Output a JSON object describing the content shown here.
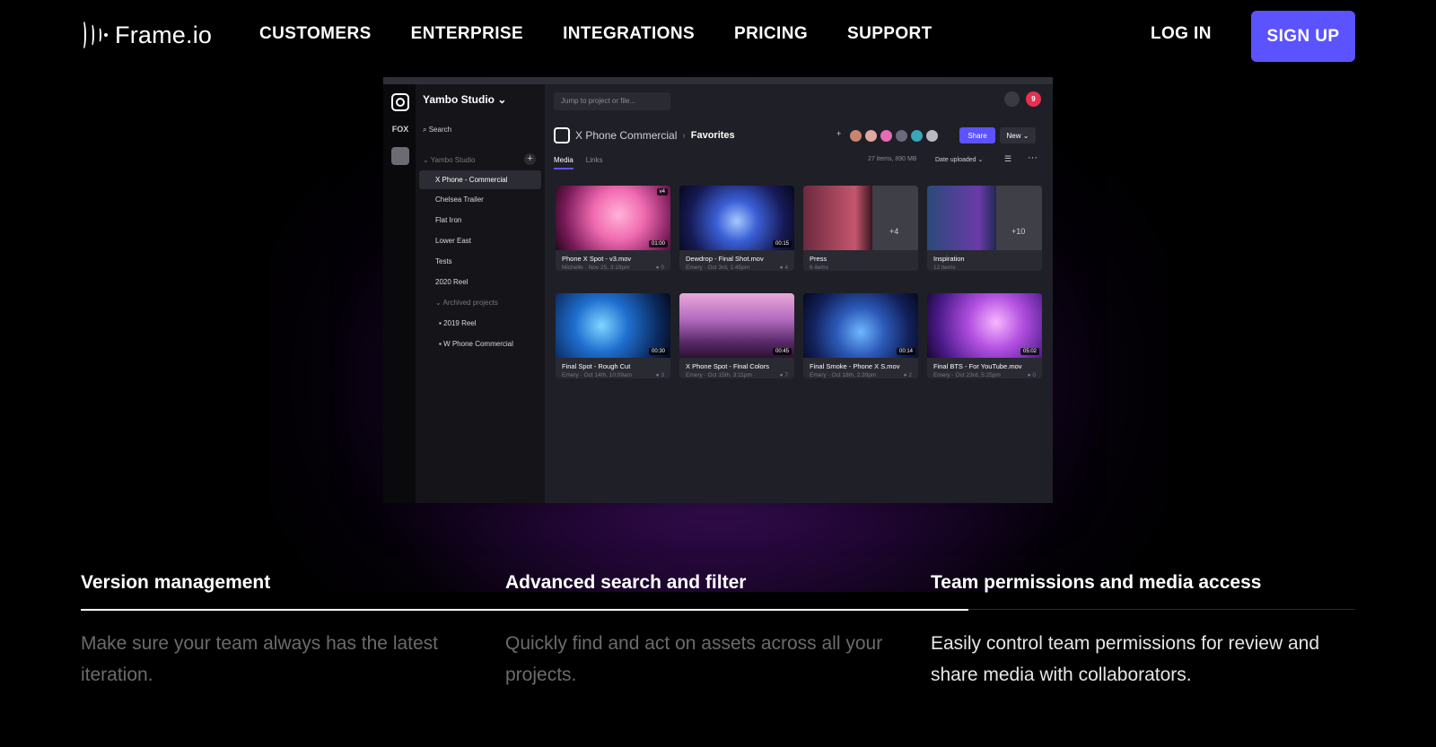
{
  "nav": {
    "logo_text": "Frame.io",
    "links": [
      "CUSTOMERS",
      "ENTERPRISE",
      "INTEGRATIONS",
      "PRICING",
      "SUPPORT"
    ],
    "login": "LOG IN",
    "signup": "SIGN UP"
  },
  "app": {
    "rail": [
      "FOX"
    ],
    "notification_count": "9",
    "workspace": "Yambo Studio ⌄",
    "search": "Search",
    "team": "Yambo Studio",
    "projects": [
      "X Phone - Commercial",
      "Chelsea Trailer",
      "Flat Iron",
      "Lower East",
      "Tests",
      "2020 Reel"
    ],
    "archived_label": "Archived projects",
    "archived": [
      "2019 Reel",
      "W Phone Commercial"
    ],
    "jump_placeholder": "Jump to project or file...",
    "breadcrumb": {
      "project": "X Phone Commercial",
      "folder": "Favorites"
    },
    "share": "Share",
    "new": "New ⌄",
    "tabs": [
      "Media",
      "Links"
    ],
    "meta": "27 items, 890 MB",
    "sort": "Date uploaded ⌄",
    "cards": [
      {
        "title": "Phone X Spot - v3.mov",
        "meta": "Michelle · Nov 25, 3:19pm",
        "comments": "0",
        "duration": "01:00",
        "badge": "v4"
      },
      {
        "title": "Dewdrop - Final Shot.mov",
        "meta": "Emery · Oct 3rd, 1:45pm",
        "comments": "4",
        "duration": "00:15"
      },
      {
        "title": "Press",
        "meta": "6 items",
        "extra": "+4"
      },
      {
        "title": "Inspiration",
        "meta": "12 items",
        "extra": "+10"
      },
      {
        "title": "Final Spot - Rough Cut",
        "meta": "Emery · Oct 14th, 10:09am",
        "comments": "3",
        "duration": "00:30"
      },
      {
        "title": "X Phone Spot - Final Colors",
        "meta": "Emery · Oct 15th, 3:11pm",
        "comments": "7",
        "duration": "00:45"
      },
      {
        "title": "Final Smoke - Phone X S.mov",
        "meta": "Emery · Oct 18th, 2:39pm",
        "comments": "2",
        "duration": "00:14"
      },
      {
        "title": "Final BTS - For YouTube.mov",
        "meta": "Emery · Oct 23rd, 5:25pm",
        "comments": "0",
        "duration": "05:02"
      }
    ]
  },
  "features": [
    {
      "title": "Version management",
      "desc": "Make sure your team always has the latest iteration."
    },
    {
      "title": "Advanced search and filter",
      "desc": "Quickly find and act on assets across all your projects."
    },
    {
      "title": "Team permissions and media access",
      "desc": "Easily control team permissions for review and share media with collaborators."
    }
  ],
  "colors": {
    "accent": "#5b53ff",
    "background": "#000000",
    "glow": "#761eaa",
    "desc_muted": "#6b6b6b",
    "desc_active": "#e6e6e6"
  }
}
